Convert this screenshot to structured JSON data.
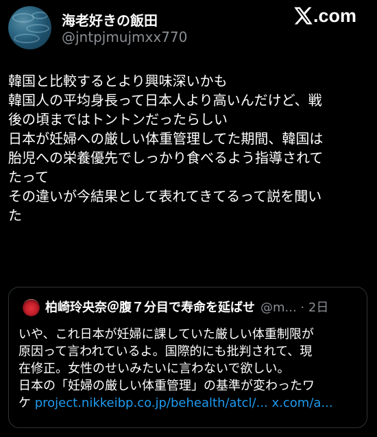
{
  "author": {
    "display_name": "海老好きの飯田",
    "handle": "@jntpjmujmxx770"
  },
  "brand": {
    "text": ".com"
  },
  "post": {
    "lines": [
      "韓国と比較するとより興味深いかも",
      "韓国人の平均身長って日本人より高いんだけど、戦",
      "後の頃まではトントンだったらしい",
      "日本が妊婦への厳しい体重管理してた期間、韓国は",
      "胎児への栄養優先でしっかり食べるよう指導されて",
      "たって",
      "その違いが今結果として表れてきてるって説を聞い",
      "た"
    ]
  },
  "quote": {
    "display_name": "柏崎玲央奈＠腹７分目で寿命を延ばせ",
    "meta": "@m... · 2日",
    "lines": [
      "いや、これ日本が妊婦に課していた厳しい体重制限が",
      "原因って言われているよ。国際的にも批判されて、現",
      "在修正。女性のせいみたいに言わないで欲しい。",
      "日本の「妊婦の厳しい体重管理」の基準が変わったワ"
    ],
    "last_line_prefix": "ケ",
    "link1": "project.nikkeibp.co.jp/behealth/atcl/...",
    "link2": "x.com/a..."
  },
  "colors": {
    "background": "#000000",
    "text": "#ffffff",
    "muted": "#8b8f94",
    "link": "#1d9bf0",
    "border": "#2f3336"
  },
  "icons": {
    "brand": "x-logo-icon",
    "author_avatar": "water-avatar",
    "quote_avatar": "red-circle-avatar"
  }
}
